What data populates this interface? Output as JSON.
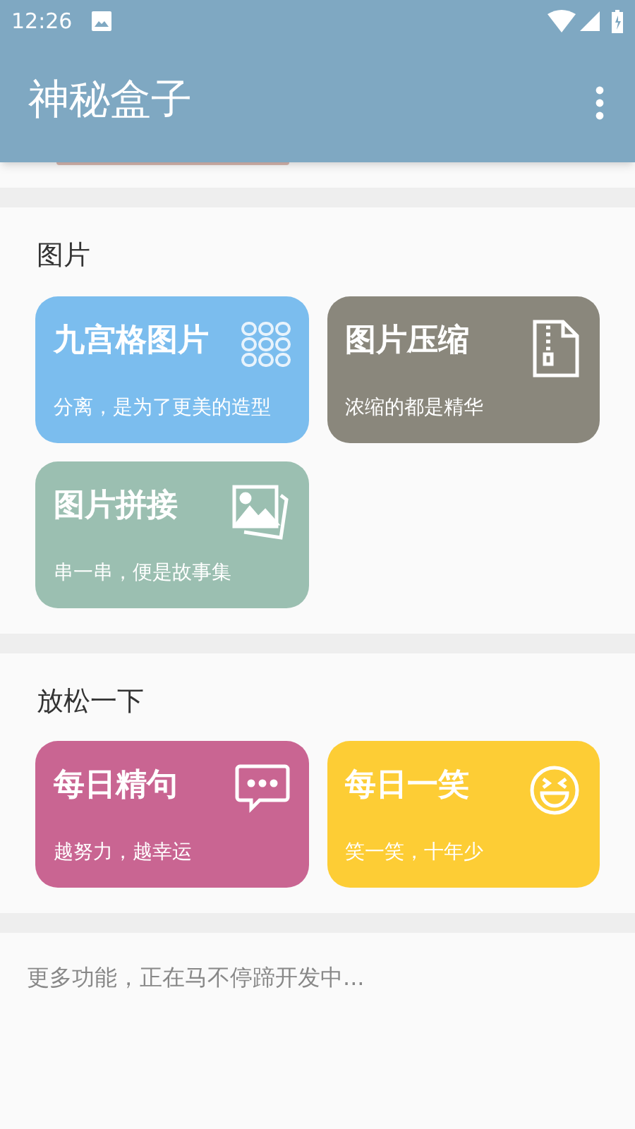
{
  "status_bar": {
    "time": "12:26"
  },
  "app_bar": {
    "title": "神秘盒子"
  },
  "sections": [
    {
      "title": "图片",
      "cards": [
        {
          "title": "九宫格图片",
          "subtitle": "分离，是为了更美的造型",
          "color": "#7bbdee"
        },
        {
          "title": "图片压缩",
          "subtitle": "浓缩的都是精华",
          "color": "#8a877c"
        },
        {
          "title": "图片拼接",
          "subtitle": "串一串，便是故事集",
          "color": "#9bbfb1"
        }
      ]
    },
    {
      "title": "放松一下",
      "cards": [
        {
          "title": "每日精句",
          "subtitle": "越努力，越幸运",
          "color": "#c96592"
        },
        {
          "title": "每日一笑",
          "subtitle": "笑一笑，十年少",
          "color": "#fdcd35"
        }
      ]
    }
  ],
  "footer": {
    "text": "更多功能，正在马不停蹄开发中..."
  }
}
